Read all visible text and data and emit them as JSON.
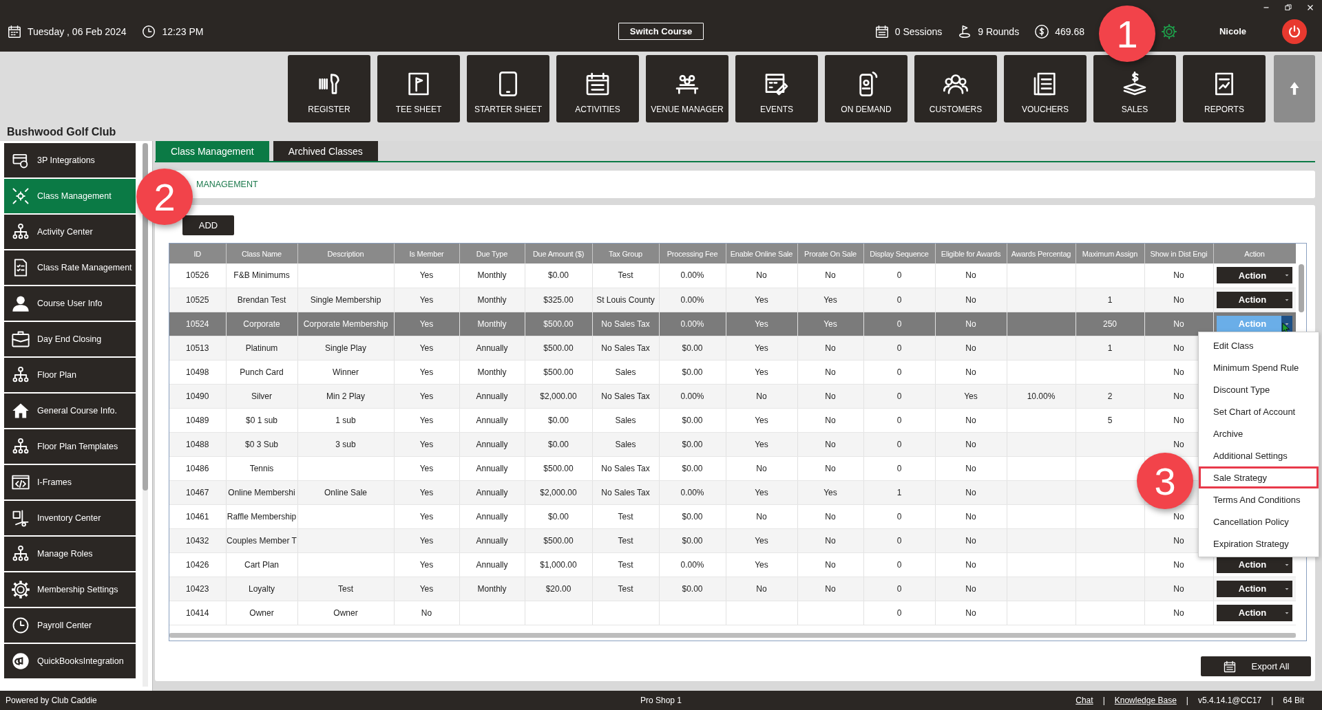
{
  "header": {
    "date": "Tuesday , 06 Feb 2024",
    "time": "12:23 PM",
    "switch_course": "Switch Course",
    "sessions": "0 Sessions",
    "rounds": "9 Rounds",
    "balance": "469.68",
    "user": "Nicole"
  },
  "toolbar": [
    {
      "label": "REGISTER"
    },
    {
      "label": "TEE SHEET"
    },
    {
      "label": "STARTER SHEET"
    },
    {
      "label": "ACTIVITIES"
    },
    {
      "label": "VENUE MANAGER"
    },
    {
      "label": "EVENTS"
    },
    {
      "label": "ON DEMAND"
    },
    {
      "label": "CUSTOMERS"
    },
    {
      "label": "VOUCHERS"
    },
    {
      "label": "SALES"
    },
    {
      "label": "REPORTS"
    }
  ],
  "club_name": "Bushwood Golf Club",
  "sidebar": {
    "items": [
      {
        "label": "3P Integrations",
        "selected": false
      },
      {
        "label": "Class Management",
        "selected": true
      },
      {
        "label": "Activity  Center",
        "selected": false
      },
      {
        "label": "Class Rate Management",
        "selected": false
      },
      {
        "label": "Course User Info",
        "selected": false
      },
      {
        "label": "Day End Closing",
        "selected": false
      },
      {
        "label": "Floor Plan",
        "selected": false
      },
      {
        "label": "General Course Info.",
        "selected": false
      },
      {
        "label": "Floor Plan Templates",
        "selected": false
      },
      {
        "label": "I-Frames",
        "selected": false
      },
      {
        "label": "Inventory Center",
        "selected": false
      },
      {
        "label": "Manage Roles",
        "selected": false
      },
      {
        "label": "Membership Settings",
        "selected": false
      },
      {
        "label": "Payroll Center",
        "selected": false
      },
      {
        "label": "QuickBooksIntegration",
        "selected": false
      }
    ]
  },
  "tabs": [
    {
      "label": "Class Management",
      "selected": true
    },
    {
      "label": "Archived Classes",
      "selected": false
    }
  ],
  "section_title": "MANAGEMENT",
  "add_button": "ADD",
  "table": {
    "columns": [
      "ID",
      "Class Name",
      "Description",
      "Is Member",
      "Due Type",
      "Due Amount ($)",
      "Tax Group",
      "Processing Fee",
      "Enable Online Sale",
      "Prorate On Sale",
      "Display Sequence",
      "Eligible for Awards",
      "Awards Percentag",
      "Maximum Assign",
      "Show in Dist Engi",
      "Action"
    ],
    "rows": [
      {
        "selected": false,
        "action": {
          "label": "Action",
          "open": false
        },
        "cells": [
          "10526",
          "F&B Minimums",
          null,
          "Yes",
          "Monthly",
          "$0.00",
          "Test",
          "0.00%",
          "No",
          "No",
          "0",
          "No",
          null,
          null,
          "No"
        ]
      },
      {
        "selected": false,
        "action": {
          "label": "Action",
          "open": false
        },
        "cells": [
          "10525",
          "Brendan Test",
          "Single Membership",
          "Yes",
          "Monthly",
          "$325.00",
          "St Louis County",
          "0.00%",
          "Yes",
          "Yes",
          "0",
          "No",
          null,
          "1",
          "No"
        ]
      },
      {
        "selected": true,
        "action": {
          "label": "Action",
          "open": true
        },
        "cells": [
          "10524",
          "Corporate",
          "Corporate Membership",
          "Yes",
          "Monthly",
          "$500.00",
          "No Sales Tax",
          "0.00%",
          "Yes",
          "Yes",
          "0",
          "No",
          null,
          "250",
          "No"
        ]
      },
      {
        "selected": false,
        "cells": [
          "10513",
          "Platinum",
          "Single Play",
          "Yes",
          "Annually",
          "$500.00",
          "No Sales Tax",
          "$0.00",
          "Yes",
          "No",
          "0",
          "No",
          null,
          "1",
          "No"
        ]
      },
      {
        "selected": false,
        "cells": [
          "10498",
          "Punch Card",
          "Winner",
          "Yes",
          "Monthly",
          "$500.00",
          "Sales",
          "$0.00",
          "Yes",
          "No",
          "0",
          "No",
          null,
          null,
          "No"
        ]
      },
      {
        "selected": false,
        "cells": [
          "10490",
          "Silver",
          "Min 2 Play",
          "Yes",
          "Annually",
          "$2,000.00",
          "No Sales Tax",
          "0.00%",
          "No",
          "No",
          "0",
          "Yes",
          "10.00%",
          "2",
          "No"
        ]
      },
      {
        "selected": false,
        "cells": [
          "10489",
          "$0 1 sub",
          "1 sub",
          "Yes",
          "Annually",
          "$0.00",
          "Sales",
          "$0.00",
          "Yes",
          "No",
          "0",
          "No",
          null,
          "5",
          "No"
        ]
      },
      {
        "selected": false,
        "cells": [
          "10488",
          "$0 3 Sub",
          "3 sub",
          "Yes",
          "Annually",
          "$0.00",
          "Sales",
          "$0.00",
          "Yes",
          "No",
          "0",
          "No",
          null,
          null,
          "No"
        ]
      },
      {
        "selected": false,
        "cells": [
          "10486",
          "Tennis",
          null,
          "Yes",
          "Annually",
          "$500.00",
          "No Sales Tax",
          "$0.00",
          "No",
          "No",
          "0",
          "No",
          null,
          null,
          null
        ]
      },
      {
        "selected": false,
        "cells": [
          "10467",
          "Online Membershi",
          "Online Sale",
          "Yes",
          "Annually",
          "$2,000.00",
          "No Sales Tax",
          "0.00%",
          "Yes",
          "Yes",
          "1",
          "No",
          null,
          null,
          null
        ]
      },
      {
        "selected": false,
        "cells": [
          "10461",
          "Raffle Membership",
          null,
          "Yes",
          "Annually",
          "$0.00",
          "Test",
          "$0.00",
          "No",
          "No",
          "0",
          "No",
          null,
          null,
          "No"
        ]
      },
      {
        "selected": false,
        "cells": [
          "10432",
          "Couples Member T",
          null,
          "Yes",
          "Annually",
          "$500.00",
          "Test",
          "$0.00",
          "Yes",
          "No",
          "0",
          "No",
          null,
          null,
          "No"
        ]
      },
      {
        "selected": false,
        "action": {
          "label": "Action",
          "open": false
        },
        "cells": [
          "10426",
          "Cart Plan",
          null,
          "Yes",
          "Annually",
          "$1,000.00",
          "Test",
          "0.00%",
          "Yes",
          "No",
          "0",
          "No",
          null,
          null,
          "No"
        ]
      },
      {
        "selected": false,
        "action": {
          "label": "Action",
          "open": false
        },
        "cells": [
          "10423",
          "Loyalty",
          "Test",
          "Yes",
          "Monthly",
          "$20.00",
          "Test",
          "$0.00",
          "No",
          "No",
          "0",
          "No",
          null,
          null,
          "No"
        ]
      },
      {
        "selected": false,
        "action": {
          "label": "Action",
          "open": false
        },
        "cells": [
          "10414",
          "Owner",
          "Owner",
          "No",
          null,
          null,
          null,
          null,
          null,
          null,
          "0",
          "No",
          null,
          null,
          "No"
        ]
      }
    ]
  },
  "action_menu": {
    "items": [
      {
        "label": "Edit Class",
        "highlighted": false
      },
      {
        "label": "Minimum Spend Rule",
        "highlighted": false
      },
      {
        "label": "Discount Type",
        "highlighted": false
      },
      {
        "label": "Set Chart of Account",
        "highlighted": false
      },
      {
        "label": "Archive",
        "highlighted": false
      },
      {
        "label": "Additional Settings",
        "highlighted": false
      },
      {
        "label": "Sale Strategy",
        "highlighted": true
      },
      {
        "label": "Terms And Conditions",
        "highlighted": false
      },
      {
        "label": "Cancellation Policy",
        "highlighted": false
      },
      {
        "label": "Expiration Strategy",
        "highlighted": false
      }
    ]
  },
  "export_button": "Export All",
  "status_bar": {
    "left": "Powered by Club Caddie",
    "center": "Pro Shop 1",
    "right": [
      {
        "kind": "link",
        "text": "Chat"
      },
      {
        "kind": "separator",
        "text": "|"
      },
      {
        "kind": "link",
        "text": "Knowledge Base"
      },
      {
        "kind": "separator",
        "text": "|"
      },
      {
        "kind": "text",
        "text": "v5.4.14.1@CC17"
      },
      {
        "kind": "separator",
        "text": "|"
      },
      {
        "kind": "text",
        "text": "64 Bit"
      }
    ]
  },
  "callouts": [
    {
      "number": "1"
    },
    {
      "number": "2"
    },
    {
      "number": "3"
    }
  ]
}
